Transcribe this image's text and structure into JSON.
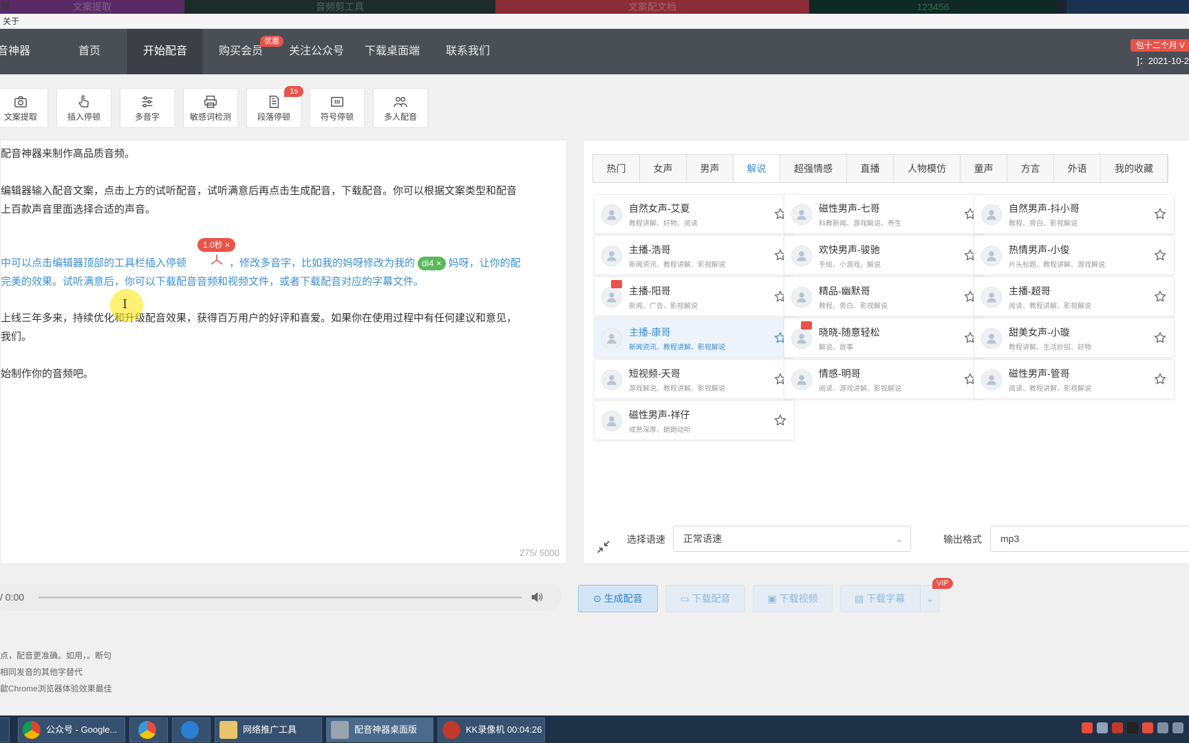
{
  "top_strip": [
    "文案提取",
    "音频剪工具",
    "文案配文档",
    "123456"
  ],
  "titlebar": {
    "corner": "版",
    "menu": "关于"
  },
  "nav": {
    "logo": "音神器",
    "items": [
      "首页",
      "开始配音",
      "购买会员",
      "关注公众号",
      "下载桌面端",
      "联系我们"
    ],
    "badge": "优惠",
    "vip_badge": "包十二个月 V",
    "date": "]：2021-10-2"
  },
  "tools": [
    {
      "label": "文案提取",
      "icon": "camera-icon"
    },
    {
      "label": "插入停顿",
      "icon": "hand-pointer-icon"
    },
    {
      "label": "多音字",
      "icon": "sliders-icon"
    },
    {
      "label": "敏感词检测",
      "icon": "printer-icon"
    },
    {
      "label": "段落停顿",
      "icon": "document-icon",
      "badge": "1s"
    },
    {
      "label": "符号停顿",
      "icon": "symbol-icon"
    },
    {
      "label": "多人配音",
      "icon": "users-icon"
    }
  ],
  "editor": {
    "line1": "配音神器来制作高品质音频。",
    "line2": "编辑器输入配音文案，点击上方的试听配音，试听满意后再点击生成配音，下载配音。你可以根据文案类型和配音",
    "line3": "上百款声音里面选择合适的声音。",
    "line4a": "中可以点击编辑器顶部的工具栏插入停顿",
    "line4b": "，修改多音字，比如我的妈呀修改为我的",
    "line4c": "妈呀，让你的配",
    "line5": "完美的效果。试听满意后，你可以下载配音音频和视频文件，或者下载配音对应的字幕文件。",
    "line6": "上线三年多来，持续优化和升级配音效果，获得百万用户的好评和喜爱。如果你在使用过程中有任何建议和意见，",
    "line7": "我们。",
    "line8": "始制作你的音频吧。",
    "pause_tag": "1.0秒 ×",
    "pin_tag": "di4 ×",
    "counter": "275/ 5000"
  },
  "voice_tabs": [
    "热门",
    "女声",
    "男声",
    "解说",
    "超强情感",
    "直播",
    "人物模仿",
    "童声",
    "方言",
    "外语",
    "我的收藏"
  ],
  "voices": [
    {
      "name": "自然女声-艾夏",
      "tags": "教程讲解、好物、阅读"
    },
    {
      "name": "磁性男声-七哥",
      "tags": "科教新闻、游戏解说、养生"
    },
    {
      "name": "自然男声-抖小哥",
      "tags": "教程、旁白、影视解说"
    },
    {
      "name": "主播-浩哥",
      "tags": "新闻资讯、教程讲解、影视解说"
    },
    {
      "name": "欢快男声-骏驰",
      "tags": "手绘、小游戏、解说"
    },
    {
      "name": "热情男声-小俊",
      "tags": "片头标题、教程讲解、游戏解说"
    },
    {
      "name": "主播-阳哥",
      "tags": "新闻、广告、影视解说"
    },
    {
      "name": "精品-幽默哥",
      "tags": "教程、旁白、影视解说"
    },
    {
      "name": "主播-超哥",
      "tags": "阅读、教程讲解、影视解说"
    },
    {
      "name": "主播-康哥",
      "tags": "新闻资讯、教程讲解、影视解说"
    },
    {
      "name": "晓晓-随意轻松",
      "tags": "解说、故事"
    },
    {
      "name": "甜美女声-小璇",
      "tags": "教程讲解、生活妙招、好物"
    },
    {
      "name": "短视频-天哥",
      "tags": "游戏解说、教程讲解、影视解说"
    },
    {
      "name": "情感-明哥",
      "tags": "阅读、游戏讲解、影视解说"
    },
    {
      "name": "磁性男声-管哥",
      "tags": "阅读、教程讲解、影视解说"
    },
    {
      "name": "磁性男声-祥仔",
      "tags": "成熟深厚、朗朗动听"
    }
  ],
  "controls": {
    "speed_label": "选择语速",
    "speed_value": "正常语速",
    "format_label": "输出格式",
    "format_value": "mp3"
  },
  "player": {
    "time": "/ 0:00"
  },
  "actions": [
    "生成配音",
    "下载配音",
    "下载视频",
    "下载字幕"
  ],
  "vip": "VIP",
  "tips": [
    "点，配音更准确。如用，。断句",
    "相同发音的其他字替代",
    "歙Chrome浏览器体验效果最佳"
  ],
  "taskbar": [
    {
      "label": "公众号 - Google..."
    },
    {
      "label": ""
    },
    {
      "label": ""
    },
    {
      "label": "网络推广工具"
    },
    {
      "label": "配音神器桌面版"
    },
    {
      "label": "KK录像机 00:04:26"
    }
  ]
}
